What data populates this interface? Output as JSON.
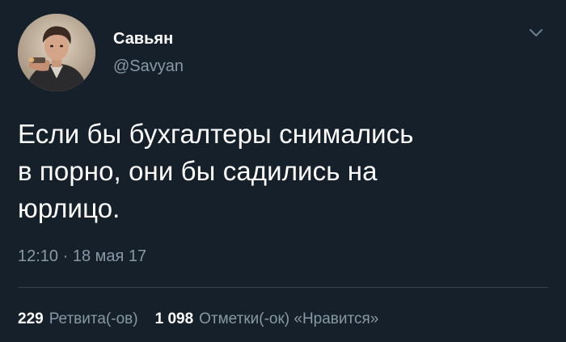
{
  "author": {
    "display_name": "Савьян",
    "handle": "@Savyan",
    "avatar_icon": "profile-photo"
  },
  "tweet": {
    "text_lines": [
      "Если бы бухгалтеры снимались",
      "в порно, они бы садились на",
      "юрлицо."
    ],
    "timestamp": "12:10 · 18 мая 17"
  },
  "stats": {
    "retweets_count": "229",
    "retweets_label": "Ретвита(-ов)",
    "likes_count": "1 098",
    "likes_label": "Отметки(-ок) «Нравится»"
  },
  "menu": {
    "icon": "chevron-down-icon"
  },
  "colors": {
    "background": "#15202b",
    "text_primary": "#ffffff",
    "text_secondary": "#8899a6",
    "divider": "#38444d"
  }
}
